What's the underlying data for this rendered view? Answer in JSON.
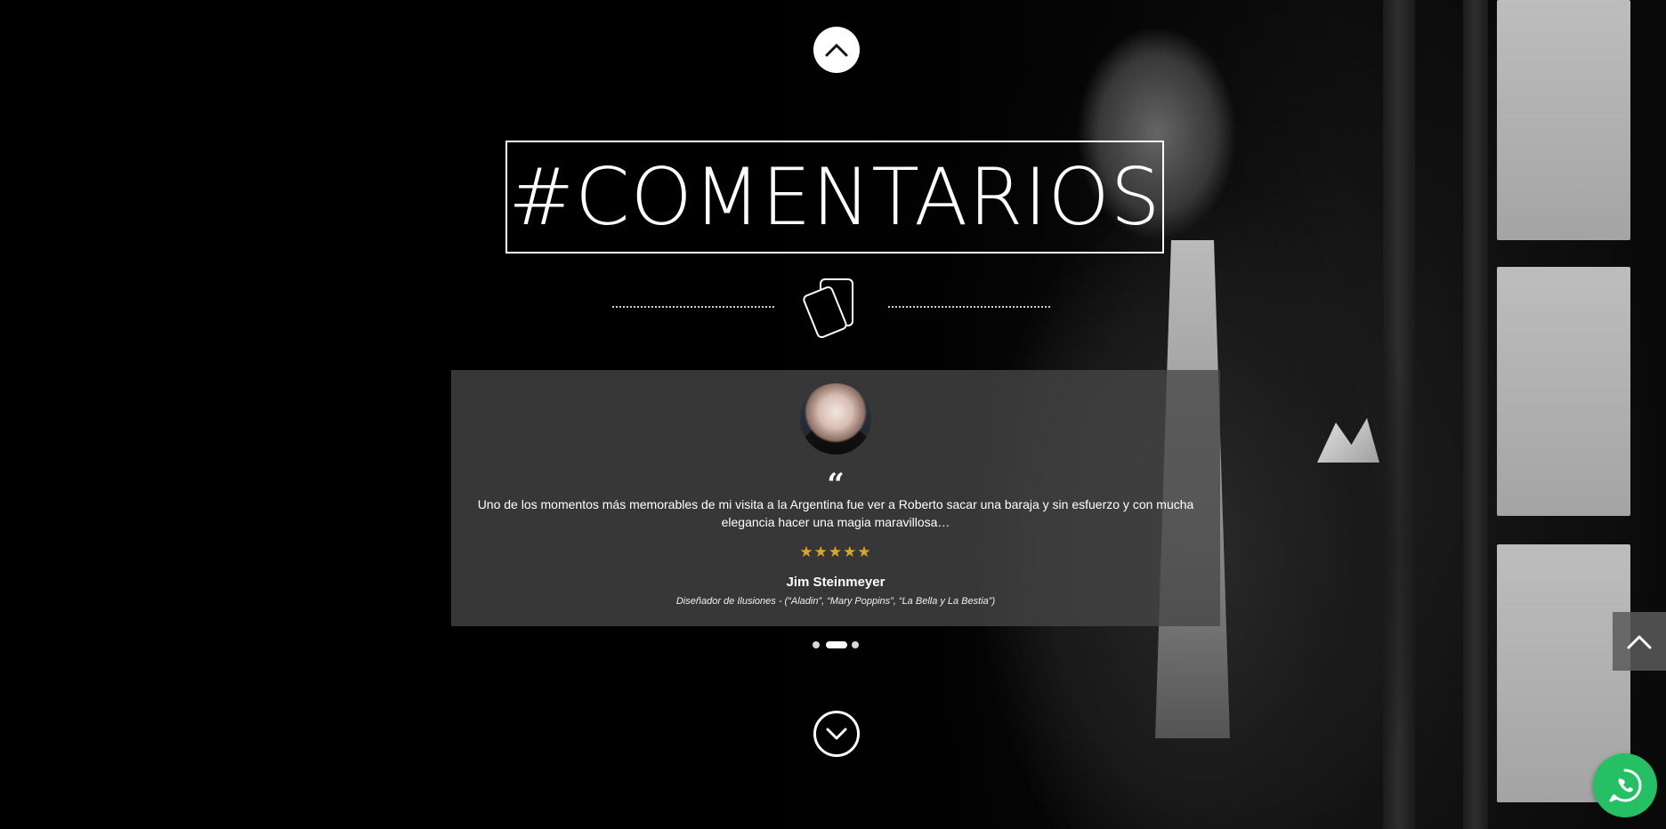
{
  "section": {
    "title": "#COMENTARIOS"
  },
  "testimonial": {
    "quote_mark": "“",
    "text": "Uno de los momentos más memorables de mi visita a la Argentina fue ver a Roberto sacar una baraja y sin esfuerzo y con mucha elegancia hacer una magia maravillosa…",
    "rating": 5,
    "stars": "★★★★★",
    "author": "Jim Steinmeyer",
    "role": "Diseñador de Ilusiones - (“Aladin”, “Mary Poppins”, “La Bella y La Bestia”)"
  },
  "carousel": {
    "total_slides": 3,
    "active_index": 1
  },
  "icons": {
    "nav_up": "chevron-up-icon",
    "nav_down": "chevron-down-circle-icon",
    "divider": "playing-cards-icon",
    "side_scroll_up": "chevron-up-icon",
    "whatsapp": "whatsapp-icon"
  },
  "colors": {
    "background": "#000000",
    "panel": "#464646",
    "stars": "#d8a62a",
    "whatsapp": "#25c063"
  }
}
